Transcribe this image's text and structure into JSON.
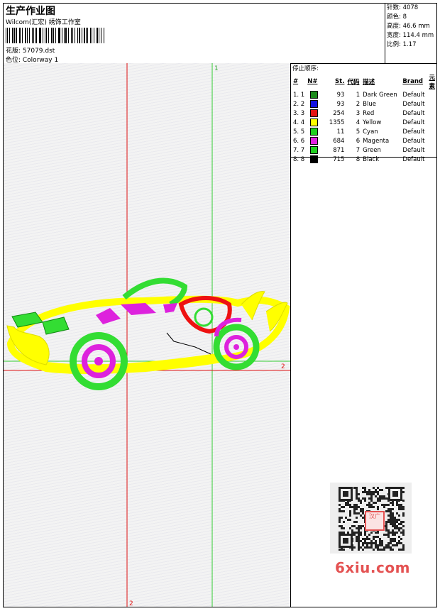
{
  "header": {
    "title": "生产作业图",
    "subtitle": "Wilcom(汇宏) 绣饰工作室",
    "design_label": "花版: 57079.dst",
    "colorway_label": "色位: Colorway 1"
  },
  "info": [
    "针数: 4078",
    "颜色: 8",
    "高度: 46.6 mm",
    "宽度: 114.4 mm",
    "比例: 1.17"
  ],
  "canvas": {
    "guide_labels": [
      "1",
      "2",
      "2"
    ]
  },
  "panel": {
    "title": "停止顺序:",
    "columns": [
      "#",
      "N#",
      "St.",
      "代码",
      "描述",
      "Brand",
      "元素"
    ],
    "rows": [
      {
        "num": "1. 1",
        "color": "#1a8a1a",
        "stitches": "93",
        "code": "1",
        "desc": "Dark Green",
        "brand": "Default"
      },
      {
        "num": "2. 2",
        "color": "#1212e0",
        "stitches": "93",
        "code": "2",
        "desc": "Blue",
        "brand": "Default"
      },
      {
        "num": "3. 3",
        "color": "#e51212",
        "stitches": "254",
        "code": "3",
        "desc": "Red",
        "brand": "Default"
      },
      {
        "num": "4. 4",
        "color": "#ffff00",
        "stitches": "1355",
        "code": "4",
        "desc": "Yellow",
        "brand": "Default"
      },
      {
        "num": "5. 5",
        "color": "#20d020",
        "stitches": "11",
        "code": "5",
        "desc": "Cyan",
        "brand": "Default"
      },
      {
        "num": "6. 6",
        "color": "#e020e0",
        "stitches": "684",
        "code": "6",
        "desc": "Magenta",
        "brand": "Default"
      },
      {
        "num": "7. 7",
        "color": "#20d020",
        "stitches": "871",
        "code": "7",
        "desc": "Green",
        "brand": "Default"
      },
      {
        "num": "8. 8",
        "color": "#000000",
        "stitches": "715",
        "code": "8",
        "desc": "Black",
        "brand": "Default"
      }
    ]
  },
  "watermark": {
    "text": "6xiu.com",
    "stamp_text": "汉广"
  },
  "colors": {
    "guide_green": "#33cc33",
    "guide_red": "#dd1111",
    "yellow": "#ffff00",
    "green": "#33dd33",
    "magenta": "#dd22dd",
    "red": "#ee1111"
  }
}
